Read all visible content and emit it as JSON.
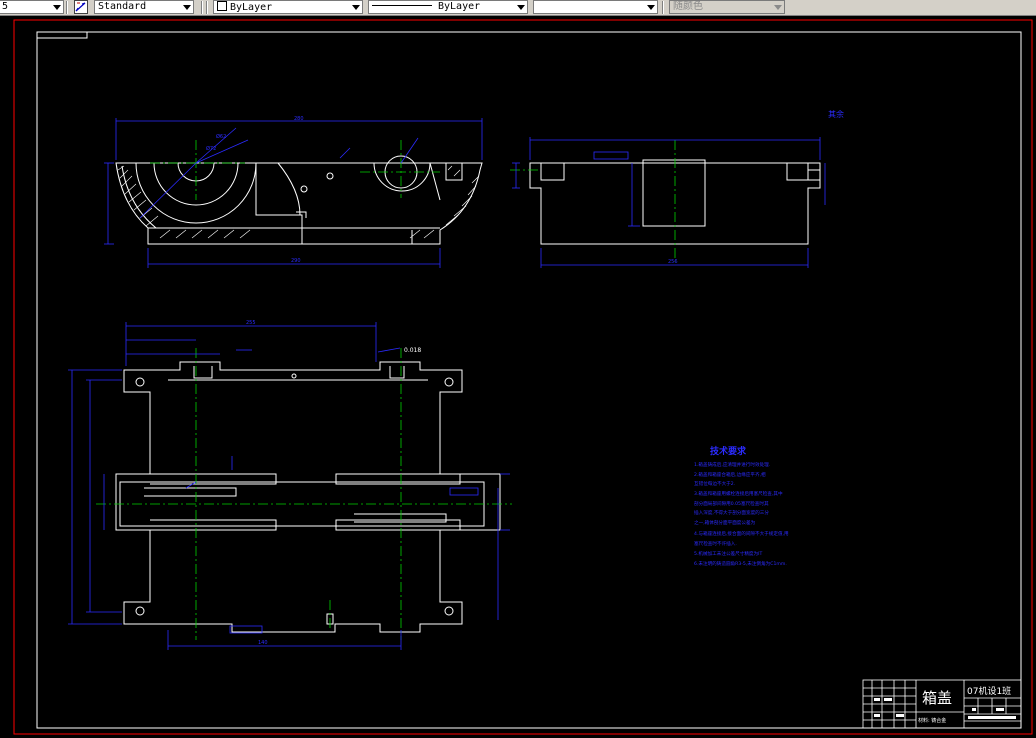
{
  "toolbar": {
    "left_value": "5",
    "style_combo": "Standard",
    "layer_combo": "ByLayer",
    "linetype_combo": "ByLayer",
    "lineweight_combo": "",
    "color_combo": "随颜色"
  },
  "icons": {
    "dimstyle": "dimension-style-icon",
    "layer_swatch": "layer-color-swatch-icon"
  },
  "colors": {
    "background": "#000000",
    "border": "#ffffff",
    "outer_frame": "#ff0000",
    "dimension": "#2b2bff",
    "centerline": "#00d000",
    "outline": "#ffffff"
  },
  "drawing": {
    "view_label": "其余",
    "tech_title": "技术要求",
    "tech_notes": [
      "1.箱盖铸成后,应清理并进行时效处理.",
      "2.箱盖和箱座合箱后,边缘应平齐,相",
      "  互错位每边不大于2.",
      "3.箱盖和箱座用螺栓连接后用塞尺检查,其中",
      "  剖分面局部间隙用0.05塞尺检查时其",
      "  插入深度,不得大于剖分面宽度的三分",
      "  之一,箱体剖分面平面度公差为",
      "4.与箱座连接后,接合面的间隙不大于规定值,用",
      "  塞尺检查时不许插入.",
      "5.机械加工未注公差尺寸精度为IT",
      "6.未注明的铸造圆角R3-5,未注倒角为C1mm."
    ],
    "dims": {
      "top_width": "280",
      "side_width": "256",
      "plan_length": "255",
      "small_a": "Ø62",
      "small_b": "Ø72",
      "tol": "0.018"
    }
  },
  "title_block": {
    "part_name": "箱盖",
    "class_label": "07机设1班",
    "material": "材料: 铸合金"
  }
}
